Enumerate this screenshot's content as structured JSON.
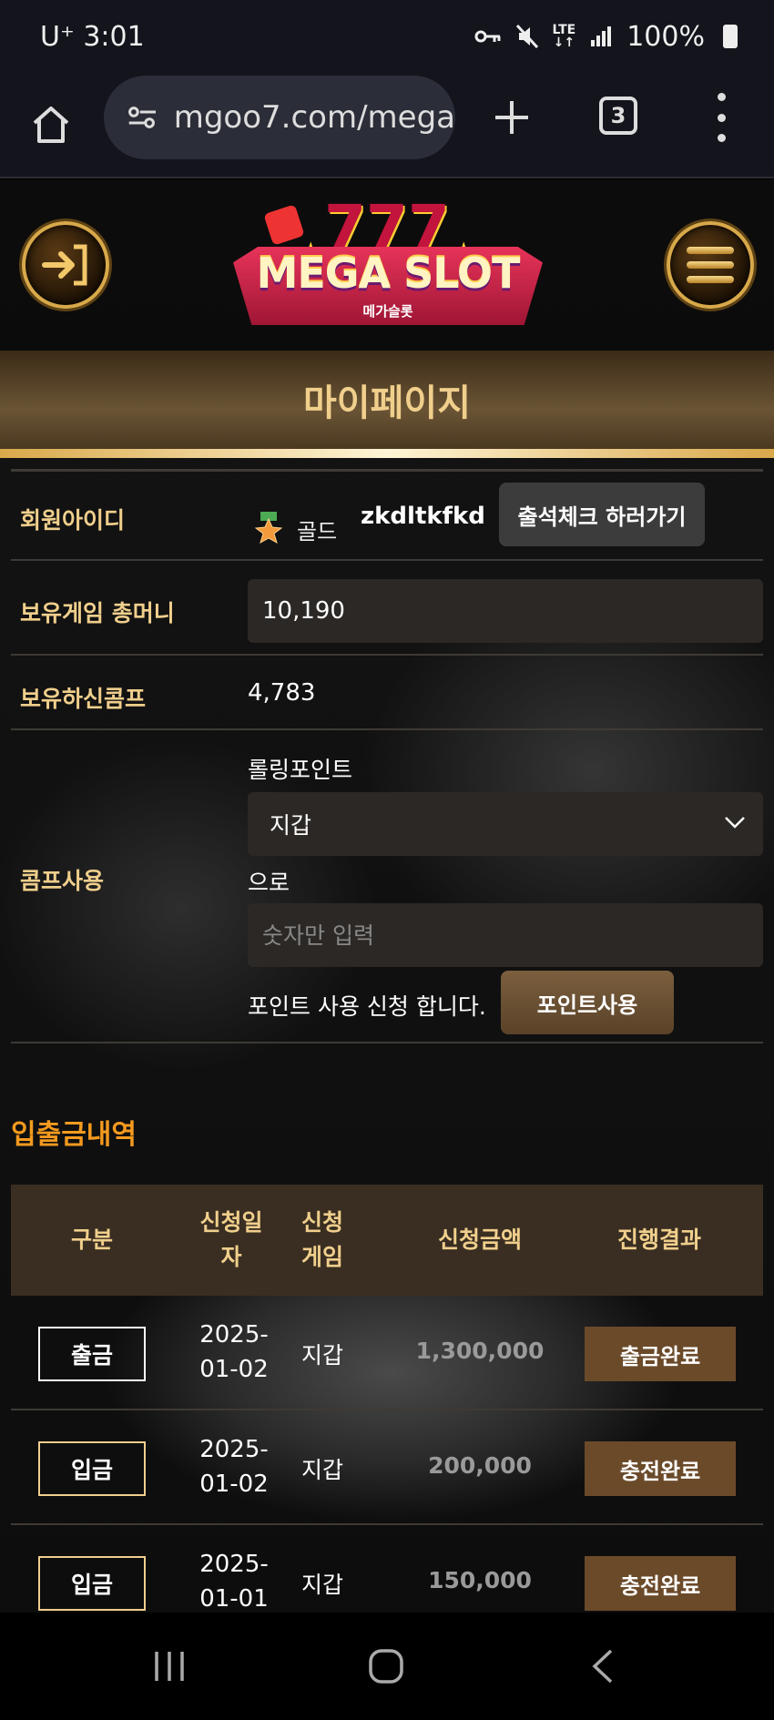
{
  "status_bar": {
    "carrier": "U⁺",
    "time": "3:01",
    "network_top": "LTE",
    "network_bottom": "↓↑",
    "battery": "100%"
  },
  "browser": {
    "url": "mgoo7.com/mega",
    "tab_count": "3"
  },
  "site": {
    "logo_text": "MEGA SLOT",
    "logo_sub": "메가슬롯",
    "logo_numbers": "777"
  },
  "page_title": "마이페이지",
  "profile": {
    "id_label": "회원아이디",
    "grade": "골드",
    "user_id": "zkdltkfkd",
    "attendance_button": "출석체크 하러가기",
    "money_label": "보유게임 총머니",
    "money_value": "10,190",
    "comp_label": "보유하신콤프",
    "comp_value": "4,783",
    "comp_use_label": "콤프사용",
    "rolling_label": "롤링포인트",
    "wallet_select": "지갑",
    "to_label": "으로",
    "amount_placeholder": "숫자만 입력",
    "apply_text": "포인트 사용 신청 합니다.",
    "use_button": "포인트사용"
  },
  "history": {
    "title": "입출금내역",
    "headers": {
      "type": "구분",
      "date_1": "신청일",
      "date_2": "자",
      "game_1": "신청",
      "game_2": "게임",
      "amount": "신청금액",
      "result": "진행결과"
    },
    "rows": [
      {
        "type": "출금",
        "date_1": "2025-",
        "date_2": "01-02",
        "game": "지갑",
        "amount": "1,300,000",
        "result": "출금완료"
      },
      {
        "type": "입금",
        "date_1": "2025-",
        "date_2": "01-02",
        "game": "지갑",
        "amount": "200,000",
        "result": "충전완료"
      },
      {
        "type": "입금",
        "date_1": "2025-",
        "date_2": "01-01",
        "game": "지갑",
        "amount": "150,000",
        "result": "충전완료"
      }
    ]
  },
  "colors": {
    "accent_gold": "#f0cf8c",
    "section_orange": "#f49a1f",
    "result_brown": "#6b4a2a"
  }
}
